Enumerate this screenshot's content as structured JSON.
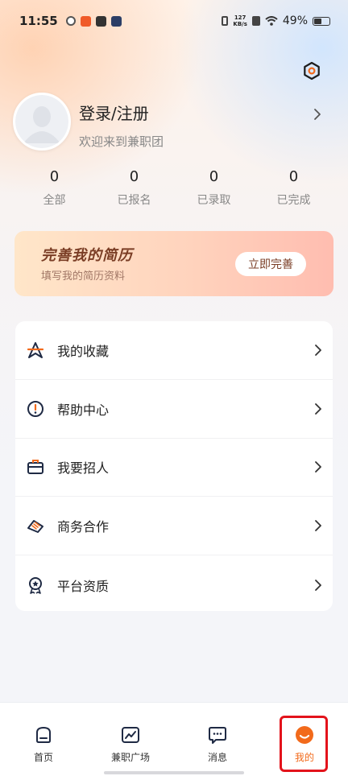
{
  "status_bar": {
    "time": "11:55",
    "net_speed_value": "127",
    "net_speed_unit": "KB/s",
    "battery": "49%"
  },
  "profile": {
    "title": "登录/注册",
    "welcome": "欢迎来到兼职团"
  },
  "stats": [
    {
      "count": "0",
      "label": "全部"
    },
    {
      "count": "0",
      "label": "已报名"
    },
    {
      "count": "0",
      "label": "已录取"
    },
    {
      "count": "0",
      "label": "已完成"
    }
  ],
  "resume_card": {
    "title": "完善我的简历",
    "subtitle": "填写我的简历资料",
    "button": "立即完善"
  },
  "menu": [
    {
      "label": "我的收藏",
      "icon": "favorite-icon"
    },
    {
      "label": "帮助中心",
      "icon": "help-icon"
    },
    {
      "label": "我要招人",
      "icon": "briefcase-icon"
    },
    {
      "label": "商务合作",
      "icon": "handshake-icon"
    },
    {
      "label": "平台资质",
      "icon": "certificate-icon"
    }
  ],
  "tabbar": [
    {
      "label": "首页",
      "icon": "home-icon"
    },
    {
      "label": "兼职广场",
      "icon": "trend-icon"
    },
    {
      "label": "消息",
      "icon": "message-icon"
    },
    {
      "label": "我的",
      "icon": "profile-icon",
      "active": true
    }
  ],
  "colors": {
    "accent": "#f26a1b",
    "resume_text": "#7a3d25",
    "highlight": "#e3131b"
  }
}
